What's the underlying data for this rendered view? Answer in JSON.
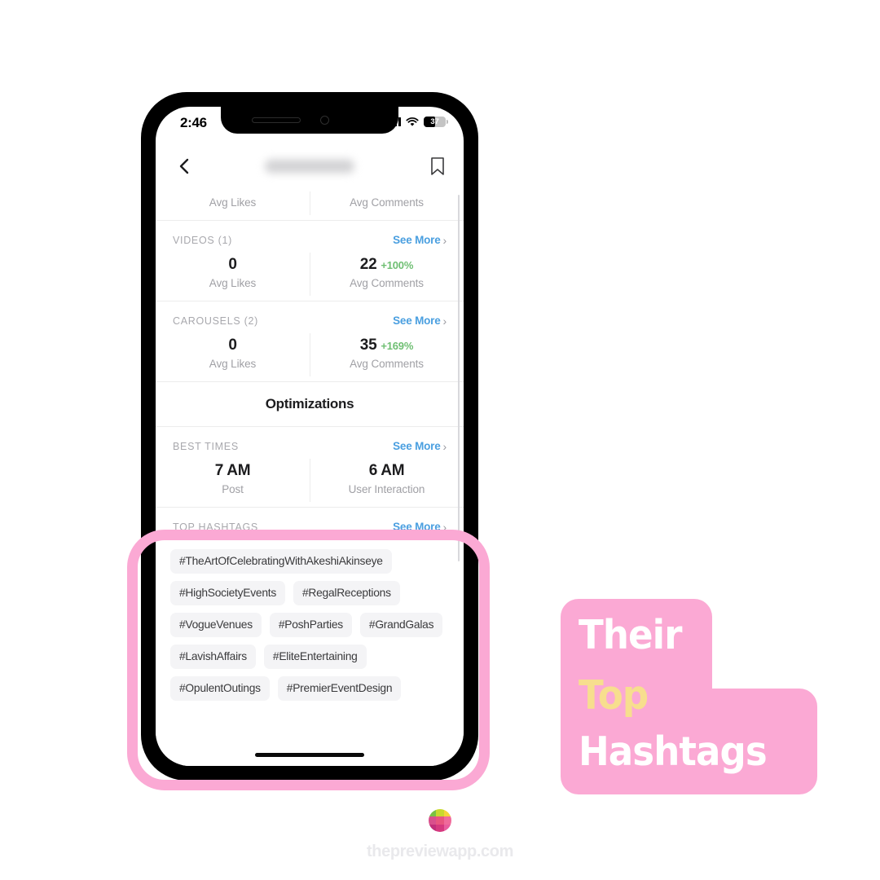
{
  "status_bar": {
    "time": "2:46",
    "battery_level": "37",
    "wifi_icon": "wifi-icon",
    "cellular_icon": "cellular-bars-icon"
  },
  "nav_bar": {
    "back_icon": "back-chevron-icon",
    "title": "",
    "bookmark_icon": "bookmark-icon"
  },
  "partial_row": {
    "left_label": "Avg Likes",
    "right_label": "Avg Comments"
  },
  "sections": [
    {
      "title": "VIDEOS (1)",
      "see_more": "See More",
      "stats": [
        {
          "value": "0",
          "delta": "",
          "label": "Avg Likes"
        },
        {
          "value": "22",
          "delta": "+100%",
          "label": "Avg Comments"
        }
      ]
    },
    {
      "title": "CAROUSELS (2)",
      "see_more": "See More",
      "stats": [
        {
          "value": "0",
          "delta": "",
          "label": "Avg Likes"
        },
        {
          "value": "35",
          "delta": "+169%",
          "label": "Avg Comments"
        }
      ]
    }
  ],
  "optimizations": {
    "banner": "Optimizations",
    "best_times": {
      "title": "BEST TIMES",
      "see_more": "See More",
      "stats": [
        {
          "value": "7 AM",
          "delta": "",
          "label": "Post"
        },
        {
          "value": "6 AM",
          "delta": "",
          "label": "User Interaction"
        }
      ]
    },
    "top_hashtags": {
      "title": "TOP HASHTAGS",
      "see_more": "See More",
      "hashtags": [
        "#TheArtOfCelebratingWithAkeshiAkinseye",
        "#HighSocietyEvents",
        "#RegalReceptions",
        "#VogueVenues",
        "#PoshParties",
        "#GrandGalas",
        "#LavishAffairs",
        "#EliteEntertaining",
        "#OpulentOutings",
        "#PremierEventDesign"
      ]
    }
  },
  "callout": {
    "line1": "Their",
    "line2": "Top",
    "line3": "Hashtags"
  },
  "brand": {
    "name": "thepreviewapp.com",
    "logo_icon": "preview-app-logo-icon",
    "logo_colors": [
      "#7ac143",
      "#c8d92e",
      "#f5d43a",
      "#d94f8c",
      "#e8557f",
      "#f06a9b",
      "#c22e7a",
      "#d6397f",
      "#e85d9e"
    ]
  },
  "colors": {
    "accent_pink": "#fba9d4",
    "callout_yellow": "#f7de8e",
    "link_blue": "#4a9fe0",
    "delta_green": "#6fbf73",
    "pill_bg": "#f4f4f6",
    "label_gray": "#a0a0a5"
  }
}
